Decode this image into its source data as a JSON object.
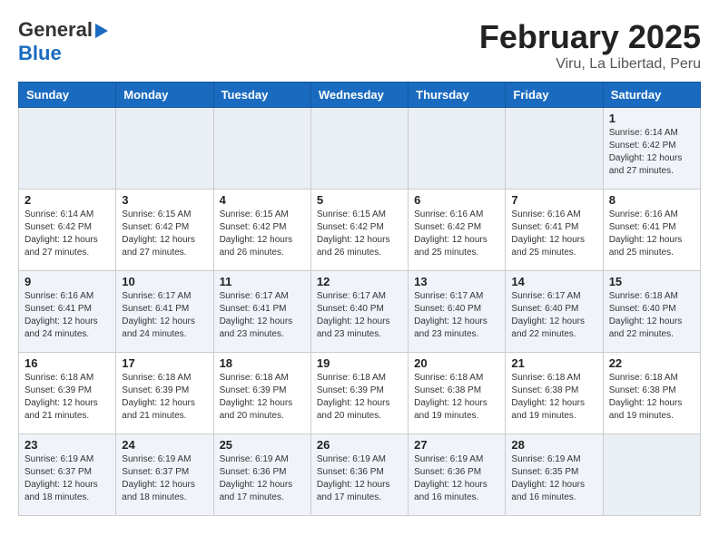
{
  "header": {
    "logo_line1": "General",
    "logo_line2": "Blue",
    "month": "February 2025",
    "location": "Viru, La Libertad, Peru"
  },
  "weekdays": [
    "Sunday",
    "Monday",
    "Tuesday",
    "Wednesday",
    "Thursday",
    "Friday",
    "Saturday"
  ],
  "weeks": [
    [
      {
        "day": "",
        "info": ""
      },
      {
        "day": "",
        "info": ""
      },
      {
        "day": "",
        "info": ""
      },
      {
        "day": "",
        "info": ""
      },
      {
        "day": "",
        "info": ""
      },
      {
        "day": "",
        "info": ""
      },
      {
        "day": "1",
        "info": "Sunrise: 6:14 AM\nSunset: 6:42 PM\nDaylight: 12 hours and 27 minutes."
      }
    ],
    [
      {
        "day": "2",
        "info": "Sunrise: 6:14 AM\nSunset: 6:42 PM\nDaylight: 12 hours and 27 minutes."
      },
      {
        "day": "3",
        "info": "Sunrise: 6:15 AM\nSunset: 6:42 PM\nDaylight: 12 hours and 27 minutes."
      },
      {
        "day": "4",
        "info": "Sunrise: 6:15 AM\nSunset: 6:42 PM\nDaylight: 12 hours and 26 minutes."
      },
      {
        "day": "5",
        "info": "Sunrise: 6:15 AM\nSunset: 6:42 PM\nDaylight: 12 hours and 26 minutes."
      },
      {
        "day": "6",
        "info": "Sunrise: 6:16 AM\nSunset: 6:42 PM\nDaylight: 12 hours and 25 minutes."
      },
      {
        "day": "7",
        "info": "Sunrise: 6:16 AM\nSunset: 6:41 PM\nDaylight: 12 hours and 25 minutes."
      },
      {
        "day": "8",
        "info": "Sunrise: 6:16 AM\nSunset: 6:41 PM\nDaylight: 12 hours and 25 minutes."
      }
    ],
    [
      {
        "day": "9",
        "info": "Sunrise: 6:16 AM\nSunset: 6:41 PM\nDaylight: 12 hours and 24 minutes."
      },
      {
        "day": "10",
        "info": "Sunrise: 6:17 AM\nSunset: 6:41 PM\nDaylight: 12 hours and 24 minutes."
      },
      {
        "day": "11",
        "info": "Sunrise: 6:17 AM\nSunset: 6:41 PM\nDaylight: 12 hours and 23 minutes."
      },
      {
        "day": "12",
        "info": "Sunrise: 6:17 AM\nSunset: 6:40 PM\nDaylight: 12 hours and 23 minutes."
      },
      {
        "day": "13",
        "info": "Sunrise: 6:17 AM\nSunset: 6:40 PM\nDaylight: 12 hours and 23 minutes."
      },
      {
        "day": "14",
        "info": "Sunrise: 6:17 AM\nSunset: 6:40 PM\nDaylight: 12 hours and 22 minutes."
      },
      {
        "day": "15",
        "info": "Sunrise: 6:18 AM\nSunset: 6:40 PM\nDaylight: 12 hours and 22 minutes."
      }
    ],
    [
      {
        "day": "16",
        "info": "Sunrise: 6:18 AM\nSunset: 6:39 PM\nDaylight: 12 hours and 21 minutes."
      },
      {
        "day": "17",
        "info": "Sunrise: 6:18 AM\nSunset: 6:39 PM\nDaylight: 12 hours and 21 minutes."
      },
      {
        "day": "18",
        "info": "Sunrise: 6:18 AM\nSunset: 6:39 PM\nDaylight: 12 hours and 20 minutes."
      },
      {
        "day": "19",
        "info": "Sunrise: 6:18 AM\nSunset: 6:39 PM\nDaylight: 12 hours and 20 minutes."
      },
      {
        "day": "20",
        "info": "Sunrise: 6:18 AM\nSunset: 6:38 PM\nDaylight: 12 hours and 19 minutes."
      },
      {
        "day": "21",
        "info": "Sunrise: 6:18 AM\nSunset: 6:38 PM\nDaylight: 12 hours and 19 minutes."
      },
      {
        "day": "22",
        "info": "Sunrise: 6:18 AM\nSunset: 6:38 PM\nDaylight: 12 hours and 19 minutes."
      }
    ],
    [
      {
        "day": "23",
        "info": "Sunrise: 6:19 AM\nSunset: 6:37 PM\nDaylight: 12 hours and 18 minutes."
      },
      {
        "day": "24",
        "info": "Sunrise: 6:19 AM\nSunset: 6:37 PM\nDaylight: 12 hours and 18 minutes."
      },
      {
        "day": "25",
        "info": "Sunrise: 6:19 AM\nSunset: 6:36 PM\nDaylight: 12 hours and 17 minutes."
      },
      {
        "day": "26",
        "info": "Sunrise: 6:19 AM\nSunset: 6:36 PM\nDaylight: 12 hours and 17 minutes."
      },
      {
        "day": "27",
        "info": "Sunrise: 6:19 AM\nSunset: 6:36 PM\nDaylight: 12 hours and 16 minutes."
      },
      {
        "day": "28",
        "info": "Sunrise: 6:19 AM\nSunset: 6:35 PM\nDaylight: 12 hours and 16 minutes."
      },
      {
        "day": "",
        "info": ""
      }
    ]
  ]
}
